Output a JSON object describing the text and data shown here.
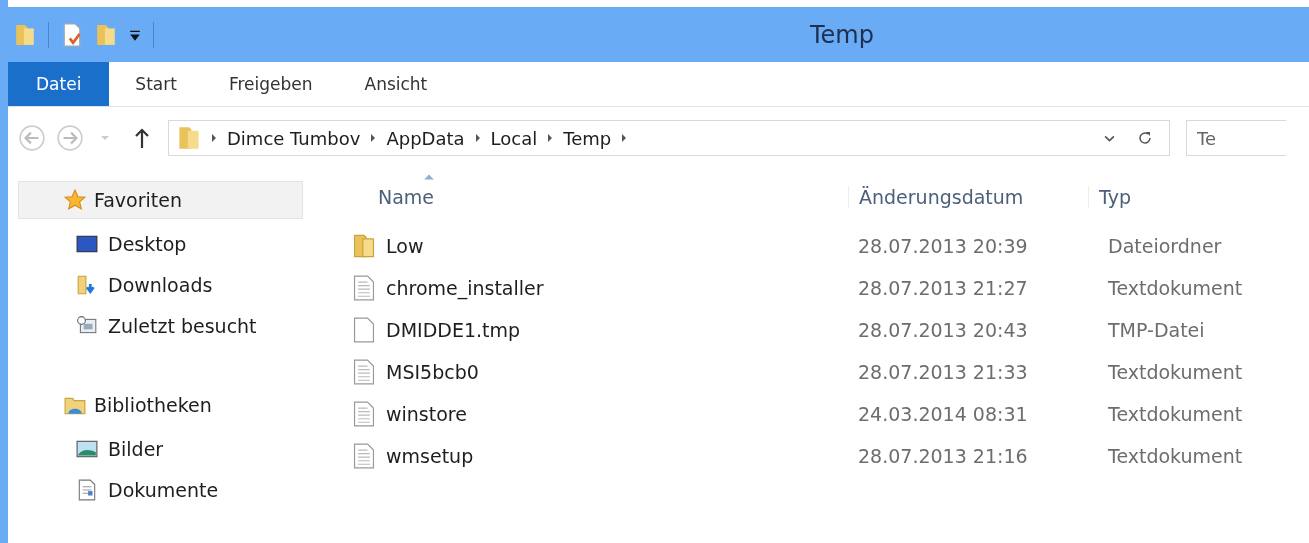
{
  "window": {
    "title": "Temp"
  },
  "ribbon_tabs": [
    {
      "label": "Datei",
      "selected": true
    },
    {
      "label": "Start",
      "selected": false
    },
    {
      "label": "Freigeben",
      "selected": false
    },
    {
      "label": "Ansicht",
      "selected": false
    }
  ],
  "address_bar": {
    "segments": [
      "Dimce Tumbov",
      "AppData",
      "Local",
      "Temp"
    ]
  },
  "search": {
    "placeholder": "Te"
  },
  "sidebar": {
    "groups": [
      {
        "label": "Favoriten",
        "kind": "favorites",
        "selected": true,
        "children": [
          {
            "label": "Desktop",
            "kind": "desktop"
          },
          {
            "label": "Downloads",
            "kind": "downloads"
          },
          {
            "label": "Zuletzt besucht",
            "kind": "recent"
          }
        ]
      },
      {
        "label": "Bibliotheken",
        "kind": "libraries",
        "selected": false,
        "children": [
          {
            "label": "Bilder",
            "kind": "pictures"
          },
          {
            "label": "Dokumente",
            "kind": "documents"
          }
        ]
      }
    ]
  },
  "table": {
    "columns": [
      "Name",
      "Änderungsdatum",
      "Typ"
    ],
    "rows": [
      {
        "kind": "folder",
        "name": "Low",
        "date": "28.07.2013 20:39",
        "type": "Dateiordner"
      },
      {
        "kind": "text",
        "name": "chrome_installer",
        "date": "28.07.2013 21:27",
        "type": "Textdokument"
      },
      {
        "kind": "file",
        "name": "DMIDDE1.tmp",
        "date": "28.07.2013 20:43",
        "type": "TMP-Datei"
      },
      {
        "kind": "text",
        "name": "MSI5bcb0",
        "date": "28.07.2013 21:33",
        "type": "Textdokument"
      },
      {
        "kind": "text",
        "name": "winstore",
        "date": "24.03.2014 08:31",
        "type": "Textdokument"
      },
      {
        "kind": "text",
        "name": "wmsetup",
        "date": "28.07.2013 21:16",
        "type": "Textdokument"
      }
    ]
  }
}
